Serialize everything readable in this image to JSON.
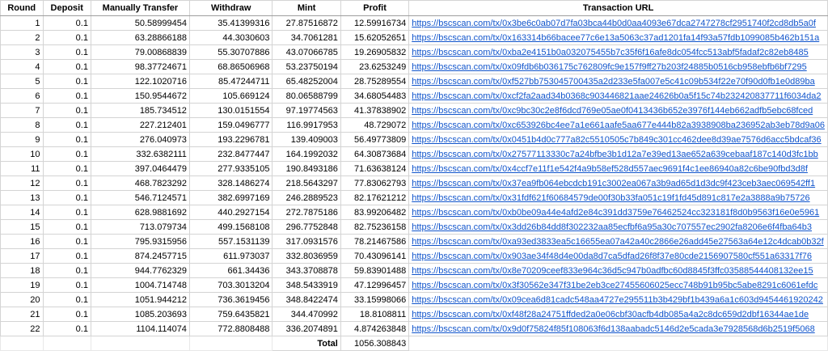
{
  "headers": [
    "Round",
    "Deposit",
    "Manually Transfer",
    "Withdraw",
    "Mint",
    "Profit",
    "Transaction URL"
  ],
  "rows": [
    [
      "1",
      "0.1",
      "50.58999454",
      "35.41399316",
      "27.87516872",
      "12.59916734",
      "https://bscscan.com/tx/0x3be6c0ab07d7fa03bca44b0d0aa4093e67dca2747278cf2951740f2cd8db5a0f"
    ],
    [
      "2",
      "0.1",
      "63.28866188",
      "44.3030603",
      "34.7061281",
      "15.62052651",
      "https://bscscan.com/tx/0x163314b66bacee77c6e13a5063c37ad1201fa14f93a57fdb1099085b462b151a"
    ],
    [
      "3",
      "0.1",
      "79.00868839",
      "55.30707886",
      "43.07066785",
      "19.26905832",
      "https://bscscan.com/tx/0xba2e4151b0a032075455b7c35f6f16afe8dc054fcc513abf5fadaf2c82eb8485"
    ],
    [
      "4",
      "0.1",
      "98.37724671",
      "68.86506968",
      "53.23750194",
      "23.6253249",
      "https://bscscan.com/tx/0x09fdb6b036175c762809fc9e157f9ff27b203f24885b0516cb958ebfb6bf7295"
    ],
    [
      "5",
      "0.1",
      "122.1020716",
      "85.47244711",
      "65.48252004",
      "28.75289554",
      "https://bscscan.com/tx/0xf527bb753045700435a2d233e5fa007e5c41c09b534f22e70f90d0fb1e0d89ba"
    ],
    [
      "6",
      "0.1",
      "150.9544672",
      "105.669124",
      "80.06588799",
      "34.68054483",
      "https://bscscan.com/tx/0xcf2fa2aad34b0368c903446821aae24626b0a5f15c74b232420837711f6034da2"
    ],
    [
      "7",
      "0.1",
      "185.734512",
      "130.0151554",
      "97.19774563",
      "41.37838902",
      "https://bscscan.com/tx/0xc9bc30c2e8f6dcd769e05ae0f0413436b652e3976f144eb662adfb5ebc68fced"
    ],
    [
      "8",
      "0.1",
      "227.212401",
      "159.0496777",
      "116.9917953",
      "48.729072",
      "https://bscscan.com/tx/0xc653926bc4ee7a1e661aafe5aa677e444b82a3938908ba236952ab3eb78d9a06"
    ],
    [
      "9",
      "0.1",
      "276.040973",
      "193.2296781",
      "139.409003",
      "56.49773809",
      "https://bscscan.com/tx/0x0451b4d0c777a82c5510505c7b849c301cc462dee8d39ae7576d6acc5bdcaf36"
    ],
    [
      "10",
      "0.1",
      "332.6382111",
      "232.8477447",
      "164.1992032",
      "64.30873684",
      "https://bscscan.com/tx/0x27577113330c7a24bfbe3b1d12a7e39ed13ae652a639cebaaf187c140d3fc1bb"
    ],
    [
      "11",
      "0.1",
      "397.0464479",
      "277.9335105",
      "190.8493186",
      "71.63638124",
      "https://bscscan.com/tx/0x4ccf7e11f1e542f4a9b58ef528d557aec9691f4c1ee86940a82c6be90fbd3d8f"
    ],
    [
      "12",
      "0.1",
      "468.7823292",
      "328.1486274",
      "218.5643297",
      "77.83062793",
      "https://bscscan.com/tx/0x37ea9fb064ebcdcb191c3002ea067a3b9ad65d1d3dc9f423ceb3aec069542ff1"
    ],
    [
      "13",
      "0.1",
      "546.7124571",
      "382.6997169",
      "246.2889523",
      "82.17621212",
      "https://bscscan.com/tx/0x31fdf621f60684579de00f30b33fa051c19f1fd45d891c817e2a3888a9b75726"
    ],
    [
      "14",
      "0.1",
      "628.9881692",
      "440.2927154",
      "272.7875186",
      "83.99206482",
      "https://bscscan.com/tx/0xb0be09a44e4afd2e84c391dd3759e76462524cc323181f8d0b9563f16e0e5961"
    ],
    [
      "15",
      "0.1",
      "713.079734",
      "499.1568108",
      "296.7752848",
      "82.75236158",
      "https://bscscan.com/tx/0x3dd26b84dd8f302232aa85ecfbf6a95a30c707557ec2902fa8206e6f4fba64b3"
    ],
    [
      "16",
      "0.1",
      "795.9315956",
      "557.1531139",
      "317.0931576",
      "78.21467586",
      "https://bscscan.com/tx/0xa93ed3833ea5c16655ea07a42a40c2866e26add45e27563a64e12c4dcab0b32f"
    ],
    [
      "17",
      "0.1",
      "874.2457715",
      "611.973037",
      "332.8036959",
      "70.43096141",
      "https://bscscan.com/tx/0x903ae34f48d4e00da8d7ca5dfad26f8f37e80cde2156907580cf551a63317f76"
    ],
    [
      "18",
      "0.1",
      "944.7762329",
      "661.34436",
      "343.3708878",
      "59.83901488",
      "https://bscscan.com/tx/0x8e70209ceef833e964c36d5c947b0adfbc60d8845f3ffc03588544408132ee15"
    ],
    [
      "19",
      "0.1",
      "1004.714748",
      "703.3013204",
      "348.5433919",
      "47.12996457",
      "https://bscscan.com/tx/0x3f30562e347f31be2eb3ce27455606025ecc748b91b95bc5abe8291c6061efdc"
    ],
    [
      "20",
      "0.1",
      "1051.944212",
      "736.3619456",
      "348.8422474",
      "33.15998066",
      "https://bscscan.com/tx/0x09cea6d81cadc548aa4727e295511b3b429bf1b439a6a1c603d9454461920242"
    ],
    [
      "21",
      "0.1",
      "1085.203693",
      "759.6435821",
      "344.470992",
      "18.8108811",
      "https://bscscan.com/tx/0xf48f28a24751ffded2a0e06cbf30acfb4db085a4a2c8dc659d2dbf16344ae1de"
    ],
    [
      "22",
      "0.1",
      "1104.114074",
      "772.8808488",
      "336.2074891",
      "4.874263848",
      "https://bscscan.com/tx/0x9d0f75824f85f108063f6d138aabadc5146d2e5cada3e7928568d6b2519f5068"
    ]
  ],
  "total": {
    "label": "Total",
    "value": "1056.308843"
  },
  "colors": {
    "link": "#1155cc",
    "gridline": "#d4d4d4",
    "header_rule": "#9e9e9e"
  }
}
